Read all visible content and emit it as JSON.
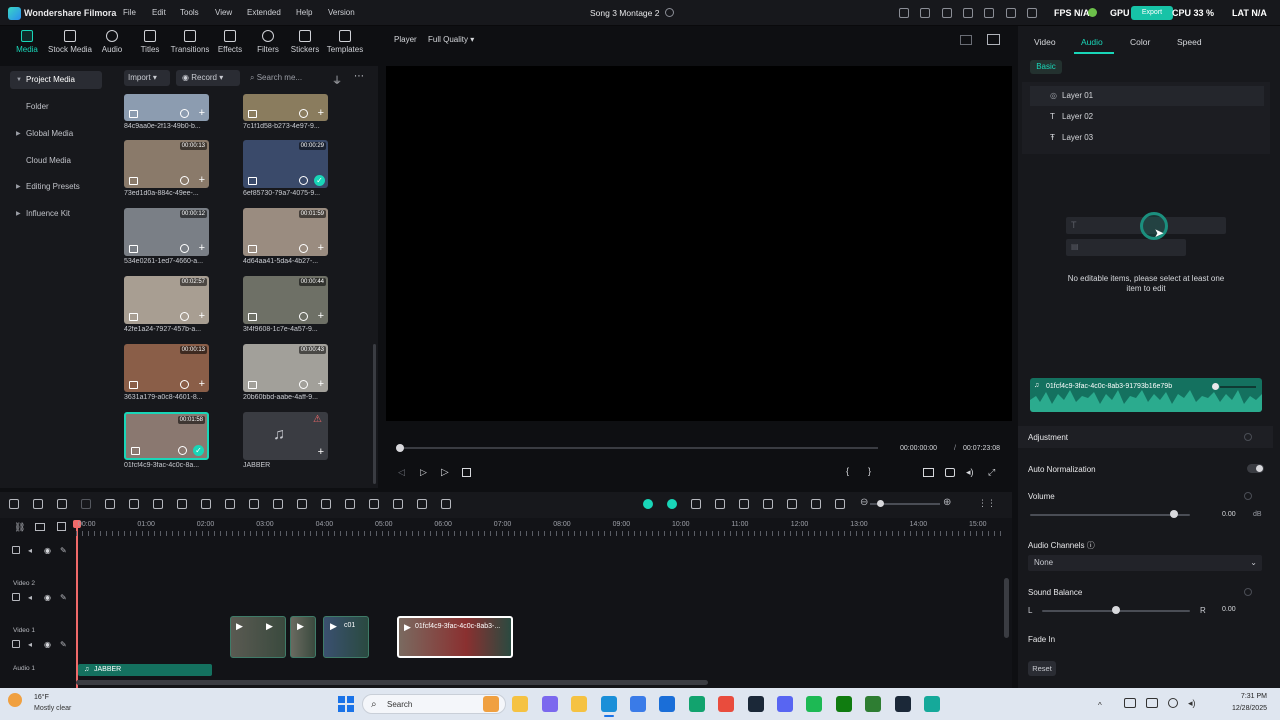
{
  "titlebar": {
    "app_name": "Wondershare Filmora",
    "menu": [
      "File",
      "Edit",
      "Tools",
      "View",
      "Extended",
      "Help",
      "Version"
    ],
    "project_title": "Song 3 Montage 2",
    "export_label": "Export",
    "fps": "FPS N/A",
    "gpu": "GPU",
    "cpu": "CPU 33 %",
    "lat": "LAT N/A"
  },
  "toolbar": {
    "items": [
      "Media",
      "Stock Media",
      "Audio",
      "Titles",
      "Transitions",
      "Effects",
      "Filters",
      "Stickers",
      "Templates"
    ]
  },
  "left_nav": {
    "project_media": "Project Media",
    "folder": "Folder",
    "global_media": "Global Media",
    "cloud_media": "Cloud Media",
    "editing_presets": "Editing Presets",
    "influence_kit": "Influence Kit"
  },
  "media": {
    "import": "Import",
    "record": "Record",
    "search_placeholder": "Search me...",
    "items": [
      {
        "caption": "84c9aa0e-2f13-49b0-b...",
        "duration": "",
        "color": "#8c9cb0"
      },
      {
        "caption": "7c1f1d58-b273-4e97-9...",
        "duration": "",
        "color": "#8a7c5e"
      },
      {
        "caption": "73ed1d0a-884c-49ee-...",
        "duration": "00:00:13",
        "color": "#8a7a6a"
      },
      {
        "caption": "6ef85730-79a7-4075-9...",
        "duration": "00:00:29",
        "color": "#3a4a6a"
      },
      {
        "caption": "534e0261-1ed7-4660-a...",
        "duration": "00:00:12",
        "color": "#7a7f86"
      },
      {
        "caption": "4d64aa41-5da4-4b27-...",
        "duration": "00:01:59",
        "color": "#9a8c80"
      },
      {
        "caption": "42fe1a24-7927-457b-a...",
        "duration": "00:02:57",
        "color": "#a89e92"
      },
      {
        "caption": "3f4f9608-1c7e-4a57-9...",
        "duration": "00:00:44",
        "color": "#6e7066"
      },
      {
        "caption": "3631a179-a0c8-4601-8...",
        "duration": "00:00:13",
        "color": "#8a5e48"
      },
      {
        "caption": "20b60bbd-aabe-4aff-9...",
        "duration": "00:00:43",
        "color": "#a2a09a"
      },
      {
        "caption": "01fcf4c9-3fac-4c0c-8a...",
        "duration": "00:01:58",
        "color": "#8a7870"
      },
      {
        "caption": "JABBER",
        "duration": "",
        "color": "#3a3c42"
      }
    ]
  },
  "player": {
    "label": "Player",
    "quality": "Full Quality",
    "current_time": "00:00:00:00",
    "separator": "/",
    "total_time": "00:07:23:08"
  },
  "right_panel": {
    "tabs": [
      "Video",
      "Audio",
      "Color",
      "Speed"
    ],
    "basic": "Basic",
    "layers": [
      "Layer 01",
      "Layer 02",
      "Layer 03"
    ],
    "empty_msg": "No editable items, please select at least one item to edit",
    "audio_clip": "01fcf4c9-3fac-4c0c-8ab3-91793b16e79b",
    "adjustment": "Adjustment",
    "auto_normalization": "Auto Normalization",
    "volume": "Volume",
    "volume_value": "0.00",
    "volume_unit": "dB",
    "volume_level": 0.9,
    "audio_channels": "Audio Channels",
    "channels_value": "None",
    "sound_balance": "Sound Balance",
    "balance_l": "L",
    "balance_r": "R",
    "balance_value": "0.00",
    "fade_in": "Fade In",
    "reset": "Reset"
  },
  "timeline": {
    "ruler": [
      "00:00",
      "01:00",
      "02:00",
      "03:00",
      "04:00",
      "05:00",
      "06:00",
      "07:00",
      "08:00",
      "09:00",
      "10:00",
      "11:00",
      "12:00",
      "13:00",
      "14:00",
      "15:00"
    ],
    "tracks": [
      "Video 2",
      "Video 1",
      "Audio 1"
    ],
    "clip_label": "01fcf4c9-3fac-4c0c-8ab3-...",
    "clip_label_short": "c01",
    "audio_label": "JABBER"
  },
  "taskbar": {
    "temp": "16°F",
    "weather": "Mostly clear",
    "search": "Search",
    "time": "7:31 PM",
    "date": "12/28/2025"
  }
}
